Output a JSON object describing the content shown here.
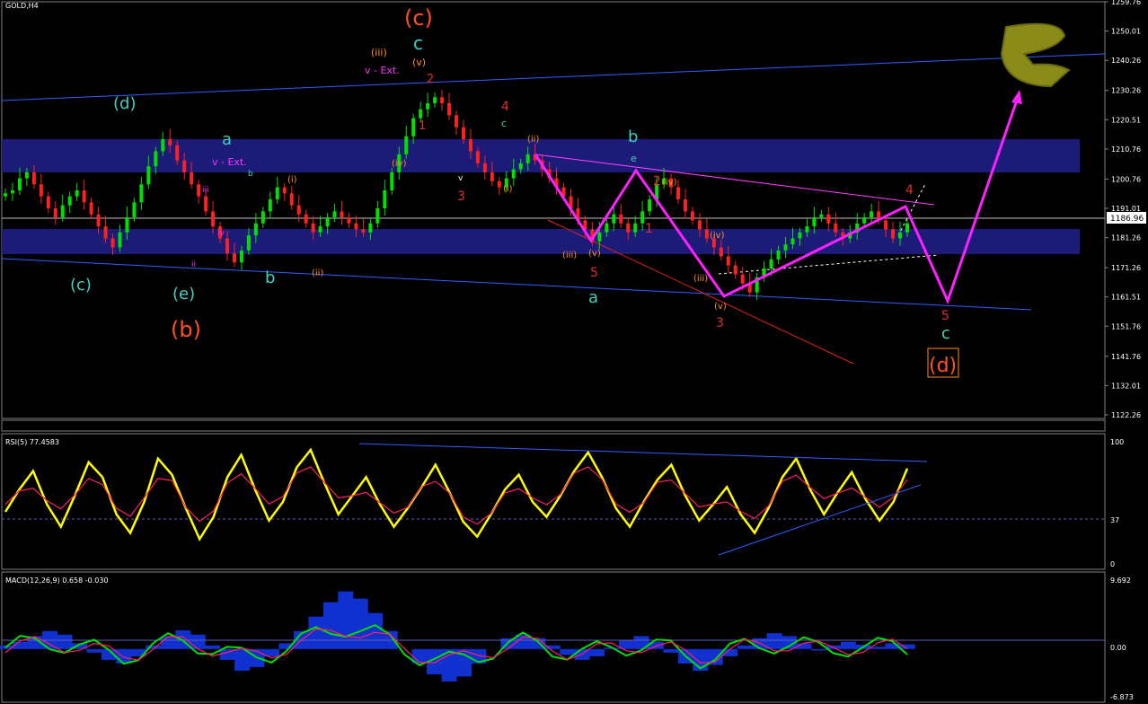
{
  "window": {
    "symbol_label": "GOLD,H4"
  },
  "price_axis": {
    "ticks": [
      "1259.76",
      "1250.01",
      "1240.26",
      "1230.26",
      "1220.51",
      "1210.76",
      "1200.76",
      "1191.01",
      "1181.26",
      "1171.26",
      "1161.51",
      "1151.76",
      "1141.76",
      "1132.01",
      "1122.26"
    ],
    "current_price": "1186.96"
  },
  "rsi_panel": {
    "title": "RSI(5) 77.4583",
    "ticks": [
      "100",
      "37",
      "0"
    ]
  },
  "macd_panel": {
    "title": "MACD(12,26,9) 0.658 -0.030",
    "ticks": [
      "9.692",
      "0.00",
      "-6.873"
    ]
  },
  "wave_labels": {
    "paren_c": "(c)",
    "c_top": "c",
    "iii_top": "(iii)",
    "v_ext_top": "v - Ext.",
    "v_top": "(v)",
    "two_top": "2",
    "one_top": "1",
    "d_wave": "(d)",
    "c_left": "(c)",
    "e_wave": "(e)",
    "b_wave": "(b)",
    "a_left": "a",
    "v_ext_left": "v - Ext.",
    "b_small": "b",
    "b_mid": "b",
    "four_mid": "4",
    "c_mid": "c",
    "three_mid": "3",
    "b_big": "b",
    "e_small": "e",
    "two_mid": "2",
    "one_mid": "1",
    "five_mid": "5",
    "a_mid": "a",
    "iii_mid": "(iii)",
    "v_mid": "(v)",
    "v_low": "(v)",
    "three_low": "3",
    "four_right": "4",
    "five_right": "5",
    "c_right": "c",
    "d_right": "(d)",
    "i_mid": "(i)",
    "ii_mid": "(ii)",
    "iv_mid": "(iv)",
    "iv_low": "(iv)",
    "ii_left": "(ii)",
    "i_left": "(i)",
    "iv_left": "(iv)",
    "iii_low": "(iii)",
    "iii_small": "iii",
    "iv_small": "iv",
    "v_small": "v",
    "ii_small": "ii"
  },
  "chart_data": [
    {
      "type": "candlestick",
      "title": "GOLD,H4",
      "ylim": [
        1122.26,
        1259.76
      ],
      "closes": [
        1196,
        1197,
        1201,
        1203,
        1199,
        1195,
        1191,
        1188,
        1192,
        1195,
        1197,
        1193,
        1189,
        1185,
        1181,
        1178,
        1183,
        1188,
        1193,
        1199,
        1205,
        1210,
        1214,
        1212,
        1207,
        1203,
        1199,
        1195,
        1190,
        1185,
        1181,
        1176,
        1173,
        1177,
        1182,
        1186,
        1190,
        1194,
        1198,
        1196,
        1192,
        1189,
        1186,
        1183,
        1185,
        1188,
        1190,
        1188,
        1186,
        1184,
        1183,
        1186,
        1191,
        1197,
        1203,
        1209,
        1215,
        1221,
        1224,
        1226,
        1228,
        1226,
        1222,
        1218,
        1214,
        1210,
        1206,
        1203,
        1200,
        1198,
        1201,
        1204,
        1206,
        1209,
        1207,
        1204,
        1201,
        1198,
        1195,
        1191,
        1187,
        1184,
        1180,
        1183,
        1186,
        1189,
        1186,
        1183,
        1186,
        1190,
        1194,
        1199,
        1201,
        1198,
        1194,
        1190,
        1187,
        1184,
        1181,
        1178,
        1175,
        1172,
        1169,
        1166,
        1163,
        1168,
        1171,
        1174,
        1177,
        1179,
        1181,
        1183,
        1185,
        1188,
        1189,
        1186,
        1183,
        1181,
        1183,
        1186,
        1188,
        1190,
        1187,
        1184,
        1181,
        1183,
        1186
      ],
      "highlight_zones": [
        [
          1200.76,
          1213.5
        ],
        [
          1175.0,
          1183.7
        ]
      ],
      "projection_path": [
        1186.96,
        1161.0,
        1232.0
      ]
    },
    {
      "type": "line",
      "title": "RSI(5) 77.4583",
      "ylim": [
        0,
        100
      ],
      "level": 37,
      "series": [
        {
          "values": [
            42,
            60,
            75,
            48,
            30,
            55,
            82,
            70,
            40,
            25,
            50,
            85,
            72,
            45,
            20,
            38,
            70,
            88,
            60,
            35,
            50,
            78,
            92,
            65,
            40,
            55,
            70,
            48,
            30,
            45,
            62,
            80,
            58,
            34,
            22,
            40,
            60,
            72,
            50,
            38,
            55,
            75,
            90,
            70,
            45,
            30,
            50,
            68,
            80,
            55,
            35,
            48,
            62,
            40,
            25,
            45,
            70,
            85,
            60,
            40,
            58,
            74,
            52,
            35,
            50,
            77
          ]
        }
      ]
    },
    {
      "type": "bar",
      "title": "MACD(12,26,9) 0.658 -0.030",
      "ylim": [
        -6.873,
        9.692
      ],
      "values": [
        0.5,
        1.0,
        1.8,
        2.5,
        2.0,
        0.8,
        -0.5,
        -1.5,
        -2.0,
        -1.0,
        0.5,
        1.8,
        2.6,
        2.0,
        0.5,
        -1.5,
        -3.0,
        -2.5,
        -1.0,
        0.8,
        2.5,
        4.5,
        6.5,
        8.0,
        7.0,
        5.0,
        2.5,
        0.0,
        -2.0,
        -3.5,
        -4.5,
        -3.8,
        -2.0,
        0.0,
        1.5,
        2.0,
        1.5,
        0.5,
        -0.8,
        -1.5,
        -1.0,
        0.2,
        1.2,
        1.8,
        1.0,
        -0.5,
        -2.0,
        -3.0,
        -2.2,
        -1.0,
        0.5,
        1.5,
        2.2,
        1.8,
        0.8,
        -0.2,
        0.5,
        1.0,
        0.6,
        0.3,
        0.8,
        0.66
      ]
    }
  ],
  "colors": {
    "candle_up": "#00e000",
    "candle_down": "#ff2020",
    "zone": "#1c1c78",
    "wave_pink": "#ff20ff",
    "wave_red": "#ff5020",
    "wave_cyan": "#40d0c0",
    "rsi": "#ffff00",
    "macd_fill": "#1030d0",
    "axis_text": "#ffffff"
  },
  "logo": {
    "icon": "logo-mark"
  }
}
